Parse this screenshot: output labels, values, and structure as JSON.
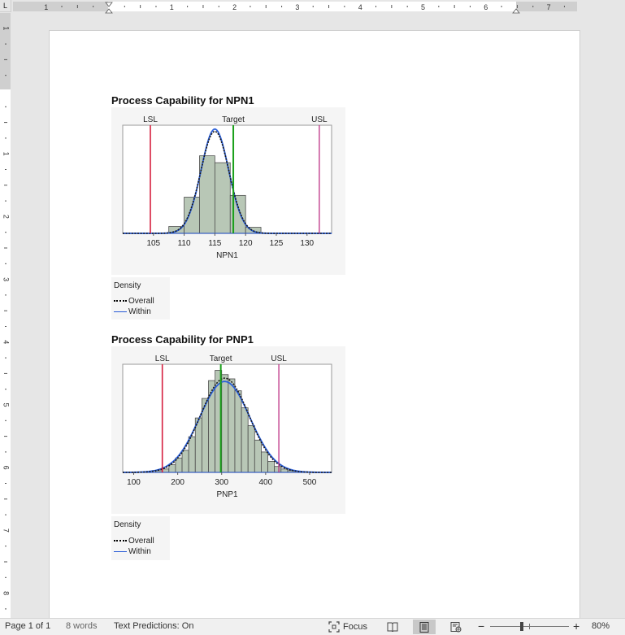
{
  "ruler": {
    "corner_label": "L",
    "h_numbers": [
      "1",
      "1",
      "2",
      "3",
      "4",
      "5",
      "6",
      "7"
    ],
    "v_numbers": [
      "1",
      "1",
      "2",
      "3",
      "4",
      "5",
      "6",
      "7",
      "8"
    ]
  },
  "charts": [
    {
      "title": "Process Capability for NPN1",
      "x_label": "NPN1",
      "ticks": [
        "105",
        "110",
        "115",
        "120",
        "125",
        "130"
      ],
      "spec_labels": {
        "lsl": "LSL",
        "target": "Target",
        "usl": "USL"
      },
      "legend": {
        "title": "Density",
        "overall": "Overall",
        "within": "Within"
      }
    },
    {
      "title": "Process Capability for PNP1",
      "x_label": "PNP1",
      "ticks": [
        "100",
        "200",
        "300",
        "400",
        "500"
      ],
      "spec_labels": {
        "lsl": "LSL",
        "target": "Target",
        "usl": "USL"
      },
      "legend": {
        "title": "Density",
        "overall": "Overall",
        "within": "Within"
      }
    }
  ],
  "chart_data": [
    {
      "type": "bar",
      "title": "Process Capability for NPN1",
      "xlabel": "NPN1",
      "xlim": [
        100,
        134
      ],
      "bin_edges": [
        107.5,
        110,
        112.5,
        115,
        117.5,
        120,
        122.5
      ],
      "counts": [
        8,
        42,
        90,
        82,
        44,
        7
      ],
      "lsl": 104.5,
      "target": 118,
      "usl": 132,
      "overall_density": {
        "mean": 115.0,
        "sd": 2.3
      },
      "within_density": {
        "mean": 115.0,
        "sd": 2.25
      }
    },
    {
      "type": "bar",
      "title": "Process Capability for PNP1",
      "xlabel": "PNP1",
      "xlim": [
        75,
        550
      ],
      "bin_edges": [
        150,
        165,
        180,
        195,
        210,
        225,
        240,
        255,
        270,
        285,
        300,
        315,
        330,
        345,
        360,
        375,
        390,
        405,
        420,
        435,
        450,
        465
      ],
      "counts": [
        2,
        4,
        9,
        17,
        26,
        42,
        64,
        87,
        108,
        120,
        115,
        110,
        96,
        76,
        55,
        38,
        24,
        13,
        7,
        4,
        2
      ],
      "lsl": 165,
      "target": 298,
      "usl": 430,
      "overall_density": {
        "mean": 307,
        "sd": 55
      },
      "within_density": {
        "mean": 307,
        "sd": 57
      }
    }
  ],
  "status": {
    "page": "Page 1 of 1",
    "words": "8 words",
    "predictions": "Text Predictions: On",
    "focus": "Focus",
    "zoom_minus": "−",
    "zoom_plus": "+",
    "zoom": "80%",
    "zoom_level": 0.4
  }
}
